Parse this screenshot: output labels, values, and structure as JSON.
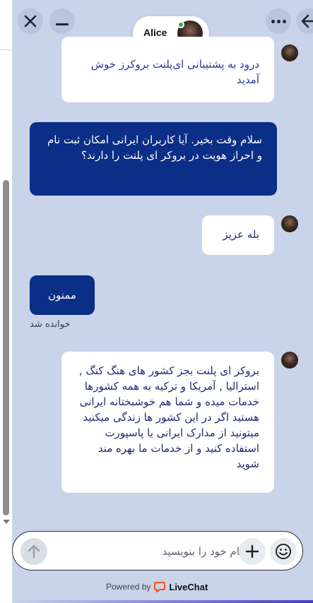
{
  "header": {
    "agent_name": "Alice",
    "close_label": "✕",
    "more_label": "more options",
    "back_label": "back"
  },
  "messages": [
    {
      "from": "agent",
      "text": "درود به پشتیبانی ای‌پلنت بروکرز خوش آمدید"
    },
    {
      "from": "visitor",
      "text": "سلام وقت بخیر. آیا کاربران ایرانی امکان ثبت نام و احراز هویت در بروکر ای پلنت را دارند؟"
    },
    {
      "from": "agent",
      "text": "بله عزیز"
    },
    {
      "from": "visitor",
      "text": "ممنون"
    },
    {
      "from": "agent",
      "text": "بروکر ای پلنت بجز کشور های هنگ کنگ , استرالیا , آمریکا و ترکیه به همه کشورها خدمات میده و شما هم خوشبختانه ایرانی هستید اگر در این کشور ها زندگی میکنید میتونید از مدارک ایرانی یا پاسپورت استفاده کنید و از خدمات ما بهره مند شوید"
    }
  ],
  "read_status": "خوانده شد",
  "composer": {
    "placeholder": "پیام خود را بنویسید"
  },
  "footer": {
    "powered_by": "Powered by",
    "brand": "LiveChat"
  },
  "colors": {
    "background": "#c9d3ea",
    "visitor_bubble": "#0b2e86",
    "agent_bubble": "#ffffff",
    "online": "#2fae4e",
    "brand_orange": "#ff5100"
  }
}
